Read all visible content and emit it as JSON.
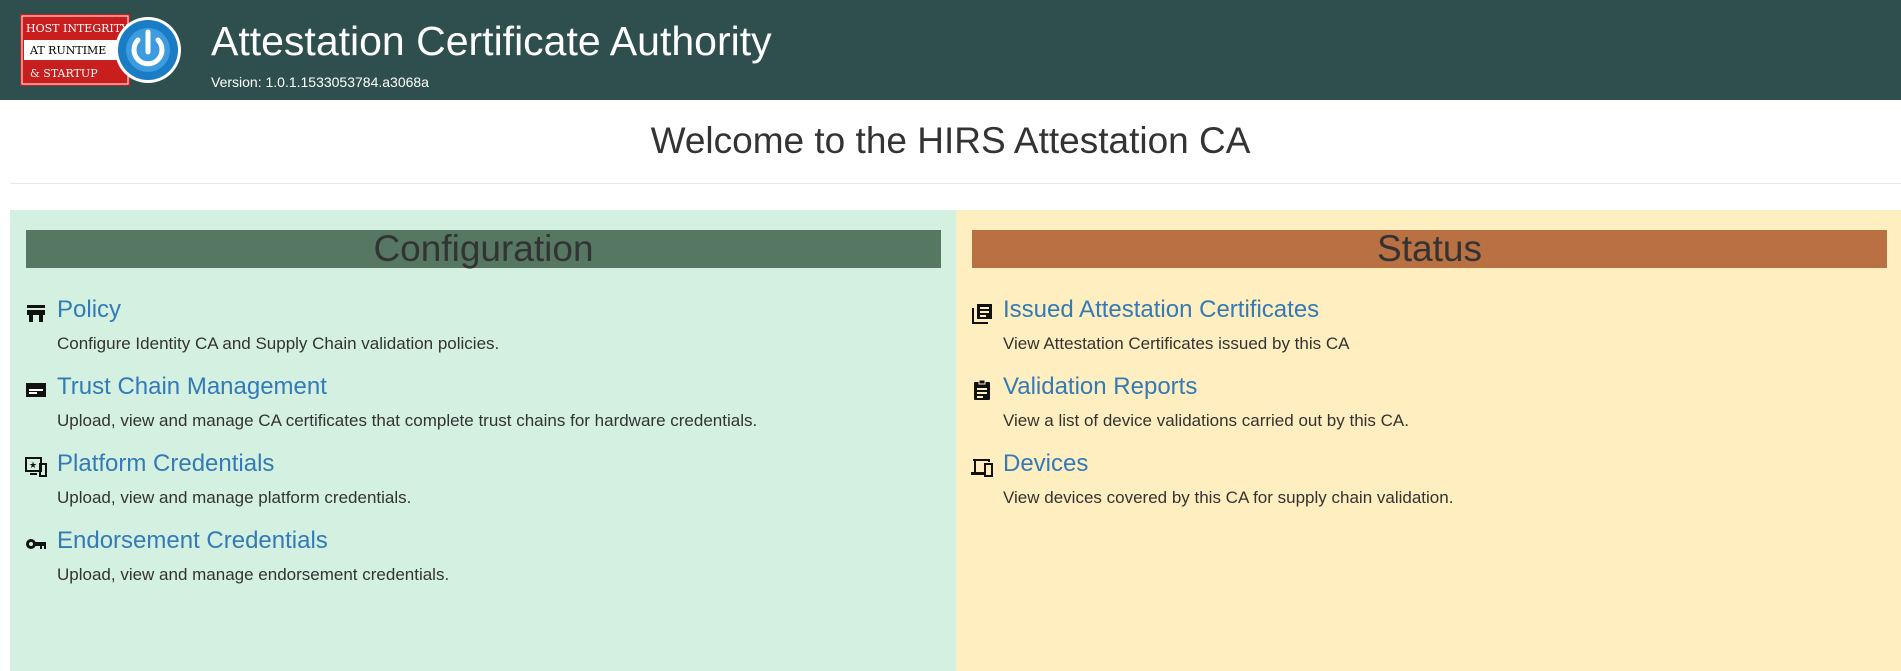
{
  "header": {
    "title": "Attestation Certificate Authority",
    "version": "Version: 1.0.1.1533053784.a3068a",
    "logo": {
      "line1": "HOST INTEGRITY",
      "line2": "AT RUNTIME",
      "line3": "& STARTUP",
      "icon": "power-icon"
    }
  },
  "welcome": "Welcome to the HIRS Attestation CA",
  "configuration": {
    "heading": "Configuration",
    "items": [
      {
        "label": "Policy",
        "description": "Configure Identity CA and Supply Chain validation policies.",
        "icon": "policy-icon"
      },
      {
        "label": "Trust Chain Management",
        "description": "Upload, view and manage CA certificates that complete trust chains for hardware credentials.",
        "icon": "trust-chain-icon"
      },
      {
        "label": "Platform Credentials",
        "description": "Upload, view and manage platform credentials.",
        "icon": "platform-credentials-icon"
      },
      {
        "label": "Endorsement Credentials",
        "description": "Upload, view and manage endorsement credentials.",
        "icon": "key-icon"
      }
    ]
  },
  "status": {
    "heading": "Status",
    "items": [
      {
        "label": "Issued Attestation Certificates",
        "description": "View Attestation Certificates issued by this CA",
        "icon": "certificates-icon"
      },
      {
        "label": "Validation Reports",
        "description": "View a list of device validations carried out by this CA.",
        "icon": "clipboard-icon"
      },
      {
        "label": "Devices",
        "description": "View devices covered by this CA for supply chain validation.",
        "icon": "devices-icon"
      }
    ]
  },
  "colors": {
    "header_bg": "#2f4f4f",
    "config_bg": "#d4f0e0",
    "config_header": "#567862",
    "status_bg": "#ffeebf",
    "status_header": "#b97043",
    "link": "#337ab7",
    "logo_red": "#c81e1e",
    "logo_blue": "#1a7cc4"
  }
}
